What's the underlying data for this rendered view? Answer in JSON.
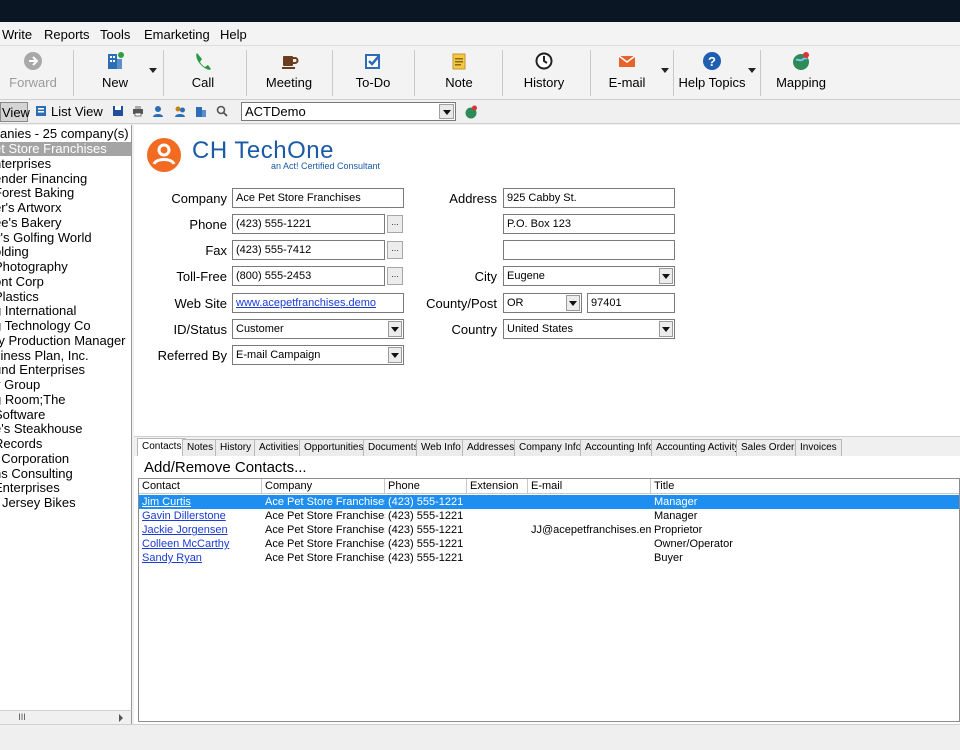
{
  "menu": [
    "Write",
    "Reports",
    "Tools",
    "Emarketing",
    "Help"
  ],
  "toolbar": {
    "forward": "Forward",
    "new": "New",
    "call": "Call",
    "meeting": "Meeting",
    "todo": "To-Do",
    "note": "Note",
    "history": "History",
    "email": "E-mail",
    "help_topics": "Help Topics",
    "mapping": "Mapping"
  },
  "subbar": {
    "detail_view": "View",
    "list_view": "List View",
    "database": "ACTDemo"
  },
  "companies": {
    "header": "anies - 25 company(s)",
    "items": [
      "et Store Franchises",
      "nterprises",
      "ender Financing",
      "Forest Baking",
      "er's Artworx",
      "ee's Bakery",
      "y's Golfing World",
      "olding",
      "Photography",
      "ont Corp",
      "Plastics",
      "g International",
      "g Technology Co",
      "ry Production Manager",
      "siness Plan, Inc.",
      "und Enterprises",
      "y Group",
      "g Room;The",
      "Software",
      "e's Steakhouse",
      "Records",
      "t Corporation",
      "ns Consulting",
      "Enterprises",
      "r Jersey Bikes"
    ],
    "selected_index": 0,
    "scroll_thumb": "III"
  },
  "logo": {
    "title": "CH TechOne",
    "subtitle": "an Act! Certified Consultant"
  },
  "form": {
    "company_label": "Company",
    "company": "Ace Pet Store Franchises",
    "phone_label": "Phone",
    "phone": "(423) 555-1221",
    "fax_label": "Fax",
    "fax": "(423) 555-7412",
    "tollfree_label": "Toll-Free",
    "tollfree": "(800) 555-2453",
    "website_label": "Web Site",
    "website": "www.acepetfranchises.demo",
    "idstatus_label": "ID/Status",
    "idstatus": "Customer",
    "referred_label": "Referred By",
    "referred": "E-mail Campaign",
    "address_label": "Address",
    "address1": "925 Cabby St.",
    "address2": "P.O. Box 123",
    "address3": "",
    "city_label": "City",
    "city": "Eugene",
    "countypost_label": "County/Post",
    "state": "OR",
    "zip": "97401",
    "country_label": "Country",
    "country": "United States",
    "dots": "..."
  },
  "tabs": [
    "Contacts",
    "Notes",
    "History",
    "Activities",
    "Opportunities",
    "Documents",
    "Web Info",
    "Addresses",
    "Company Info",
    "Accounting Info",
    "Accounting Activity",
    "Sales Orders",
    "Invoices"
  ],
  "contacts": {
    "title": "Add/Remove Contacts...",
    "columns": [
      "Contact",
      "Company",
      "Phone",
      "Extension",
      "E-mail",
      "Title"
    ],
    "rows": [
      {
        "contact": "Jim Curtis",
        "company": "Ace Pet Store Franchises",
        "phone": "(423) 555-1221",
        "extension": "",
        "email": "",
        "title": "Manager"
      },
      {
        "contact": "Gavin Dillerstone",
        "company": "Ace Pet Store Franchises",
        "phone": "(423) 555-1221",
        "extension": "",
        "email": "",
        "title": "Manager"
      },
      {
        "contact": "Jackie Jorgensen",
        "company": "Ace Pet Store Franchises",
        "phone": "(423) 555-1221",
        "extension": "",
        "email": "JJ@acepetfranchises.em",
        "title": "Proprietor"
      },
      {
        "contact": "Colleen McCarthy",
        "company": "Ace Pet Store Franchises",
        "phone": "(423) 555-1221",
        "extension": "",
        "email": "",
        "title": "Owner/Operator"
      },
      {
        "contact": "Sandy Ryan",
        "company": "Ace Pet Store Franchises",
        "phone": "(423) 555-1221",
        "extension": "",
        "email": "",
        "title": "Buyer"
      }
    ]
  }
}
